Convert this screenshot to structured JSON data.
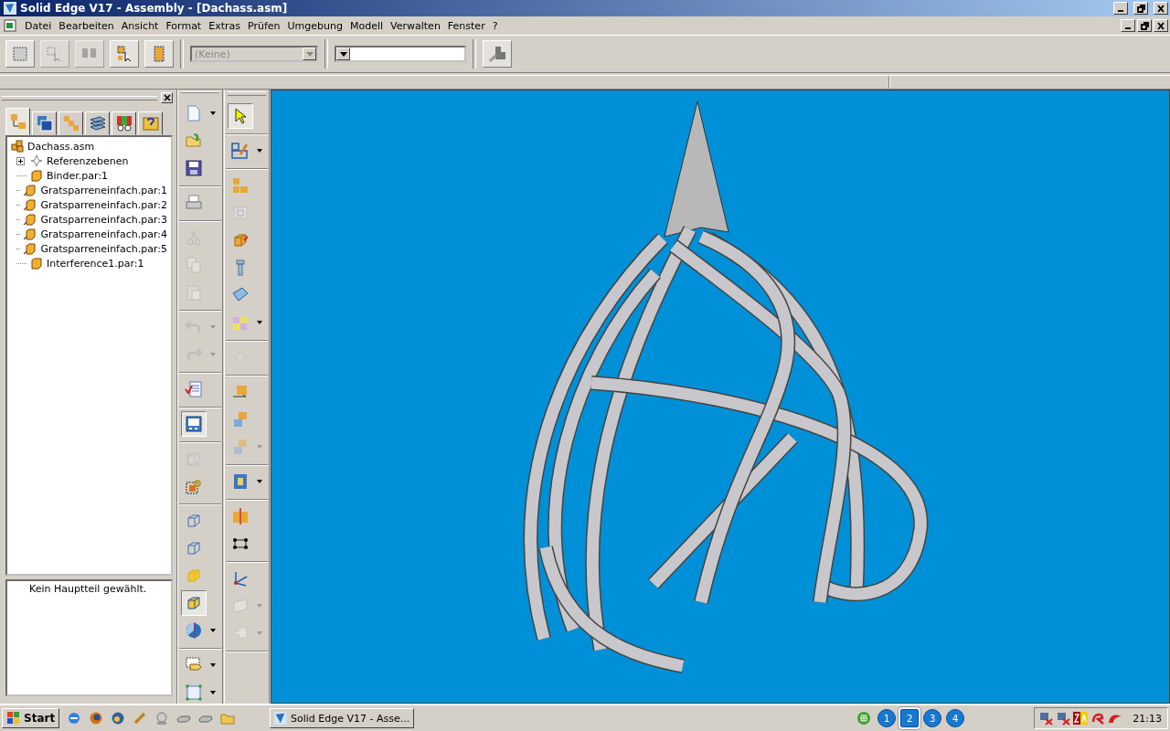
{
  "window": {
    "title": "Solid Edge V17 - Assembly - [Dachass.asm]"
  },
  "menu": [
    "Datei",
    "Bearbeiten",
    "Ansicht",
    "Format",
    "Extras",
    "Prüfen",
    "Umgebung",
    "Modell",
    "Verwalten",
    "Fenster",
    "?"
  ],
  "toolbar": {
    "tools": [
      {
        "kind": "frame-select",
        "disabled": false
      },
      {
        "kind": "pick-select",
        "disabled": true
      },
      {
        "kind": "pair-select",
        "disabled": true
      },
      {
        "kind": "part-select",
        "disabled": false
      },
      {
        "kind": "stack-select",
        "disabled": false
      }
    ],
    "combo_1": {
      "value": "(Keine)",
      "disabled": true
    },
    "combo_2": {
      "disabled": false
    }
  },
  "panel": {
    "tabs": [
      {
        "kind": "tree",
        "selected": true
      },
      {
        "kind": "layers",
        "selected": false
      },
      {
        "kind": "parts",
        "selected": false
      },
      {
        "kind": "sheets",
        "selected": false
      },
      {
        "kind": "colors",
        "selected": false
      },
      {
        "kind": "help",
        "selected": false
      }
    ],
    "tree": {
      "label": "Dachass.asm",
      "kind": "assembly",
      "children": [
        {
          "label": "Referenzebenen",
          "kind": "planes",
          "expanded": false
        },
        {
          "label": "Binder.par:1",
          "kind": "part"
        },
        {
          "label": "Gratsparreneinfach.par:1",
          "kind": "linked-part"
        },
        {
          "label": "Gratsparreneinfach.par:2",
          "kind": "linked-part"
        },
        {
          "label": "Gratsparreneinfach.par:3",
          "kind": "linked-part"
        },
        {
          "label": "Gratsparreneinfach.par:4",
          "kind": "linked-part"
        },
        {
          "label": "Gratsparreneinfach.par:5",
          "kind": "linked-part"
        },
        {
          "label": "Interference1.par:1",
          "kind": "part"
        }
      ]
    },
    "message": "Kein Hauptteil gewählt."
  },
  "toolbars": [
    [
      [
        {
          "kind": "page",
          "dropdown": true,
          "disabled": false,
          "pressed": false
        },
        {
          "kind": "folder",
          "dropdown": false,
          "disabled": false,
          "pressed": false
        },
        {
          "kind": "floppy",
          "dropdown": false,
          "disabled": false,
          "pressed": false
        }
      ],
      [
        {
          "kind": "printer",
          "dropdown": false,
          "disabled": false,
          "pressed": false
        }
      ],
      [
        {
          "kind": "scissors",
          "dropdown": false,
          "disabled": true,
          "pressed": false
        },
        {
          "kind": "copy",
          "dropdown": false,
          "disabled": true,
          "pressed": false
        },
        {
          "kind": "paste",
          "dropdown": false,
          "disabled": true,
          "pressed": false
        }
      ],
      [
        {
          "kind": "undo",
          "dropdown": true,
          "disabled": true,
          "pressed": false
        },
        {
          "kind": "redo",
          "dropdown": true,
          "disabled": true,
          "pressed": false
        }
      ],
      [
        {
          "kind": "checklist",
          "dropdown": false,
          "disabled": false,
          "pressed": false
        }
      ],
      [
        {
          "kind": "panel",
          "dropdown": false,
          "disabled": false,
          "pressed": true
        }
      ],
      [
        {
          "kind": "cube-dashed",
          "dropdown": false,
          "disabled": true,
          "pressed": false
        },
        {
          "kind": "cube-link",
          "dropdown": false,
          "disabled": false,
          "pressed": false
        }
      ],
      [
        {
          "kind": "wire-cube",
          "dropdown": false,
          "disabled": false,
          "pressed": false
        },
        {
          "kind": "wire-cube",
          "dropdown": false,
          "disabled": false,
          "pressed": false
        },
        {
          "kind": "solid-cube",
          "dropdown": false,
          "disabled": false,
          "pressed": false
        },
        {
          "kind": "shaded-cube",
          "dropdown": false,
          "disabled": false,
          "pressed": true
        },
        {
          "kind": "sphere",
          "dropdown": true,
          "disabled": false,
          "pressed": false
        }
      ],
      [
        {
          "kind": "tag",
          "dropdown": true,
          "disabled": false,
          "pressed": false
        },
        {
          "kind": "box-select",
          "dropdown": true,
          "disabled": false,
          "pressed": false
        }
      ]
    ],
    [
      [
        {
          "kind": "arrow",
          "dropdown": false,
          "disabled": false,
          "pressed": true
        }
      ],
      [
        {
          "kind": "sketch",
          "dropdown": true,
          "disabled": false,
          "pressed": false
        }
      ],
      [
        {
          "kind": "assembly",
          "dropdown": false,
          "disabled": false,
          "pressed": false
        },
        {
          "kind": "part-box",
          "dropdown": false,
          "disabled": true,
          "pressed": false
        },
        {
          "kind": "cube-red",
          "dropdown": false,
          "disabled": false,
          "pressed": false
        },
        {
          "kind": "bolt",
          "dropdown": false,
          "disabled": false,
          "pressed": false
        },
        {
          "kind": "plate",
          "dropdown": false,
          "disabled": false,
          "pressed": false
        },
        {
          "kind": "grid",
          "dropdown": true,
          "disabled": false,
          "pressed": false
        }
      ],
      [
        {
          "kind": "diamond",
          "dropdown": false,
          "disabled": true,
          "pressed": false
        }
      ],
      [
        {
          "kind": "move",
          "dropdown": false,
          "disabled": false,
          "pressed": false
        },
        {
          "kind": "blocks",
          "dropdown": false,
          "disabled": false,
          "pressed": false
        },
        {
          "kind": "blocks",
          "dropdown": true,
          "disabled": true,
          "pressed": false
        }
      ],
      [
        {
          "kind": "frame",
          "dropdown": true,
          "disabled": false,
          "pressed": false
        }
      ],
      [
        {
          "kind": "cut",
          "dropdown": false,
          "disabled": false,
          "pressed": false
        },
        {
          "kind": "chain",
          "dropdown": false,
          "disabled": false,
          "pressed": false
        }
      ],
      [
        {
          "kind": "axes",
          "dropdown": false,
          "disabled": false,
          "pressed": false
        },
        {
          "kind": "plane",
          "dropdown": true,
          "disabled": true,
          "pressed": false
        },
        {
          "kind": "flag",
          "dropdown": true,
          "disabled": true,
          "pressed": false
        }
      ]
    ]
  ],
  "taskbar": {
    "start": "Start",
    "quick_launch": [
      {
        "kind": "ie"
      },
      {
        "kind": "firefox"
      },
      {
        "kind": "thunderbird"
      },
      {
        "kind": "tool"
      },
      {
        "kind": "drive"
      },
      {
        "kind": "disk"
      },
      {
        "kind": "disk"
      },
      {
        "kind": "folder"
      }
    ],
    "task": {
      "label": "Solid Edge V17 - Asse...",
      "selected": false
    },
    "desktops": [
      {
        "label": "1",
        "selected": false
      },
      {
        "label": "2",
        "selected": true
      },
      {
        "label": "3",
        "selected": false
      },
      {
        "label": "4",
        "selected": false
      }
    ],
    "tray": [
      {
        "kind": "network-off"
      },
      {
        "kind": "network-off"
      },
      {
        "kind": "za"
      },
      {
        "kind": "antivir"
      },
      {
        "kind": "ati"
      }
    ],
    "clock": "21:13"
  }
}
